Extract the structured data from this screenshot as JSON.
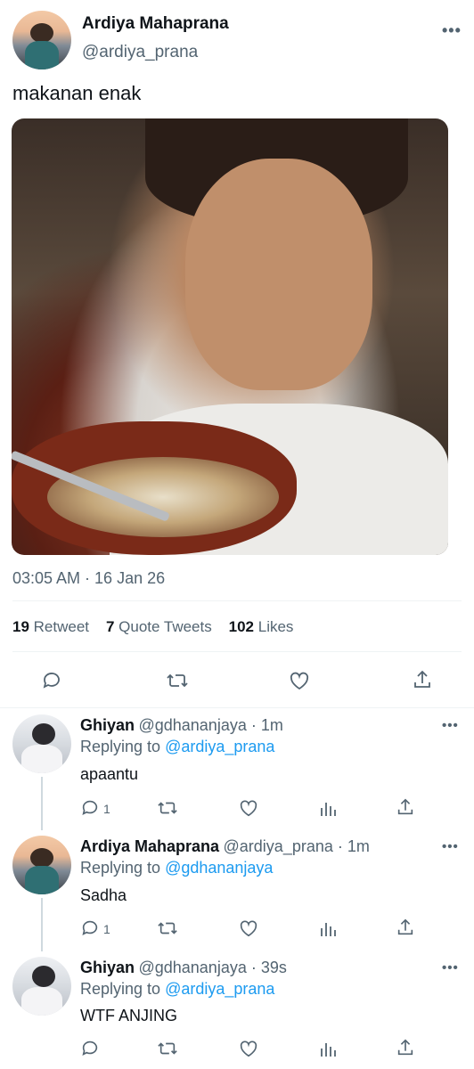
{
  "main": {
    "author_name": "Ardiya Mahaprana",
    "author_handle": "@ardiya_prana",
    "more": "•••",
    "text": "makanan enak",
    "timestamp": "03:05 AM · 16 Jan 26",
    "stats": {
      "retweets_count": "19",
      "retweets_label": "Retweet",
      "quotes_count": "7",
      "quotes_label": "Quote Tweets",
      "likes_count": "102",
      "likes_label": "Likes"
    }
  },
  "replies": [
    {
      "name": "Ghiyan",
      "handle_time": "@gdhananjaya · 1m",
      "replying_prefix": "Replying to",
      "replying_to": "@ardiya_prana",
      "text": "apaantu",
      "reply_count": "1",
      "more": "•••"
    },
    {
      "name": "Ardiya Mahaprana",
      "handle_time": "@ardiya_prana · 1m",
      "replying_prefix": "Replying to",
      "replying_to": "@gdhananjaya",
      "text": "Sadha",
      "reply_count": "1",
      "more": "•••"
    },
    {
      "name": "Ghiyan",
      "handle_time": "@gdhananjaya · 39s",
      "replying_prefix": "Replying to",
      "replying_to": "@ardiya_prana",
      "text": "WTF ANJING",
      "reply_count": "",
      "more": "•••"
    }
  ],
  "colors": {
    "link": "#1d9bf0",
    "muted": "#536471",
    "text": "#0f1419"
  },
  "icons": [
    "comment-icon",
    "retweet-icon",
    "like-icon",
    "share-icon",
    "analytics-icon",
    "more-icon"
  ]
}
